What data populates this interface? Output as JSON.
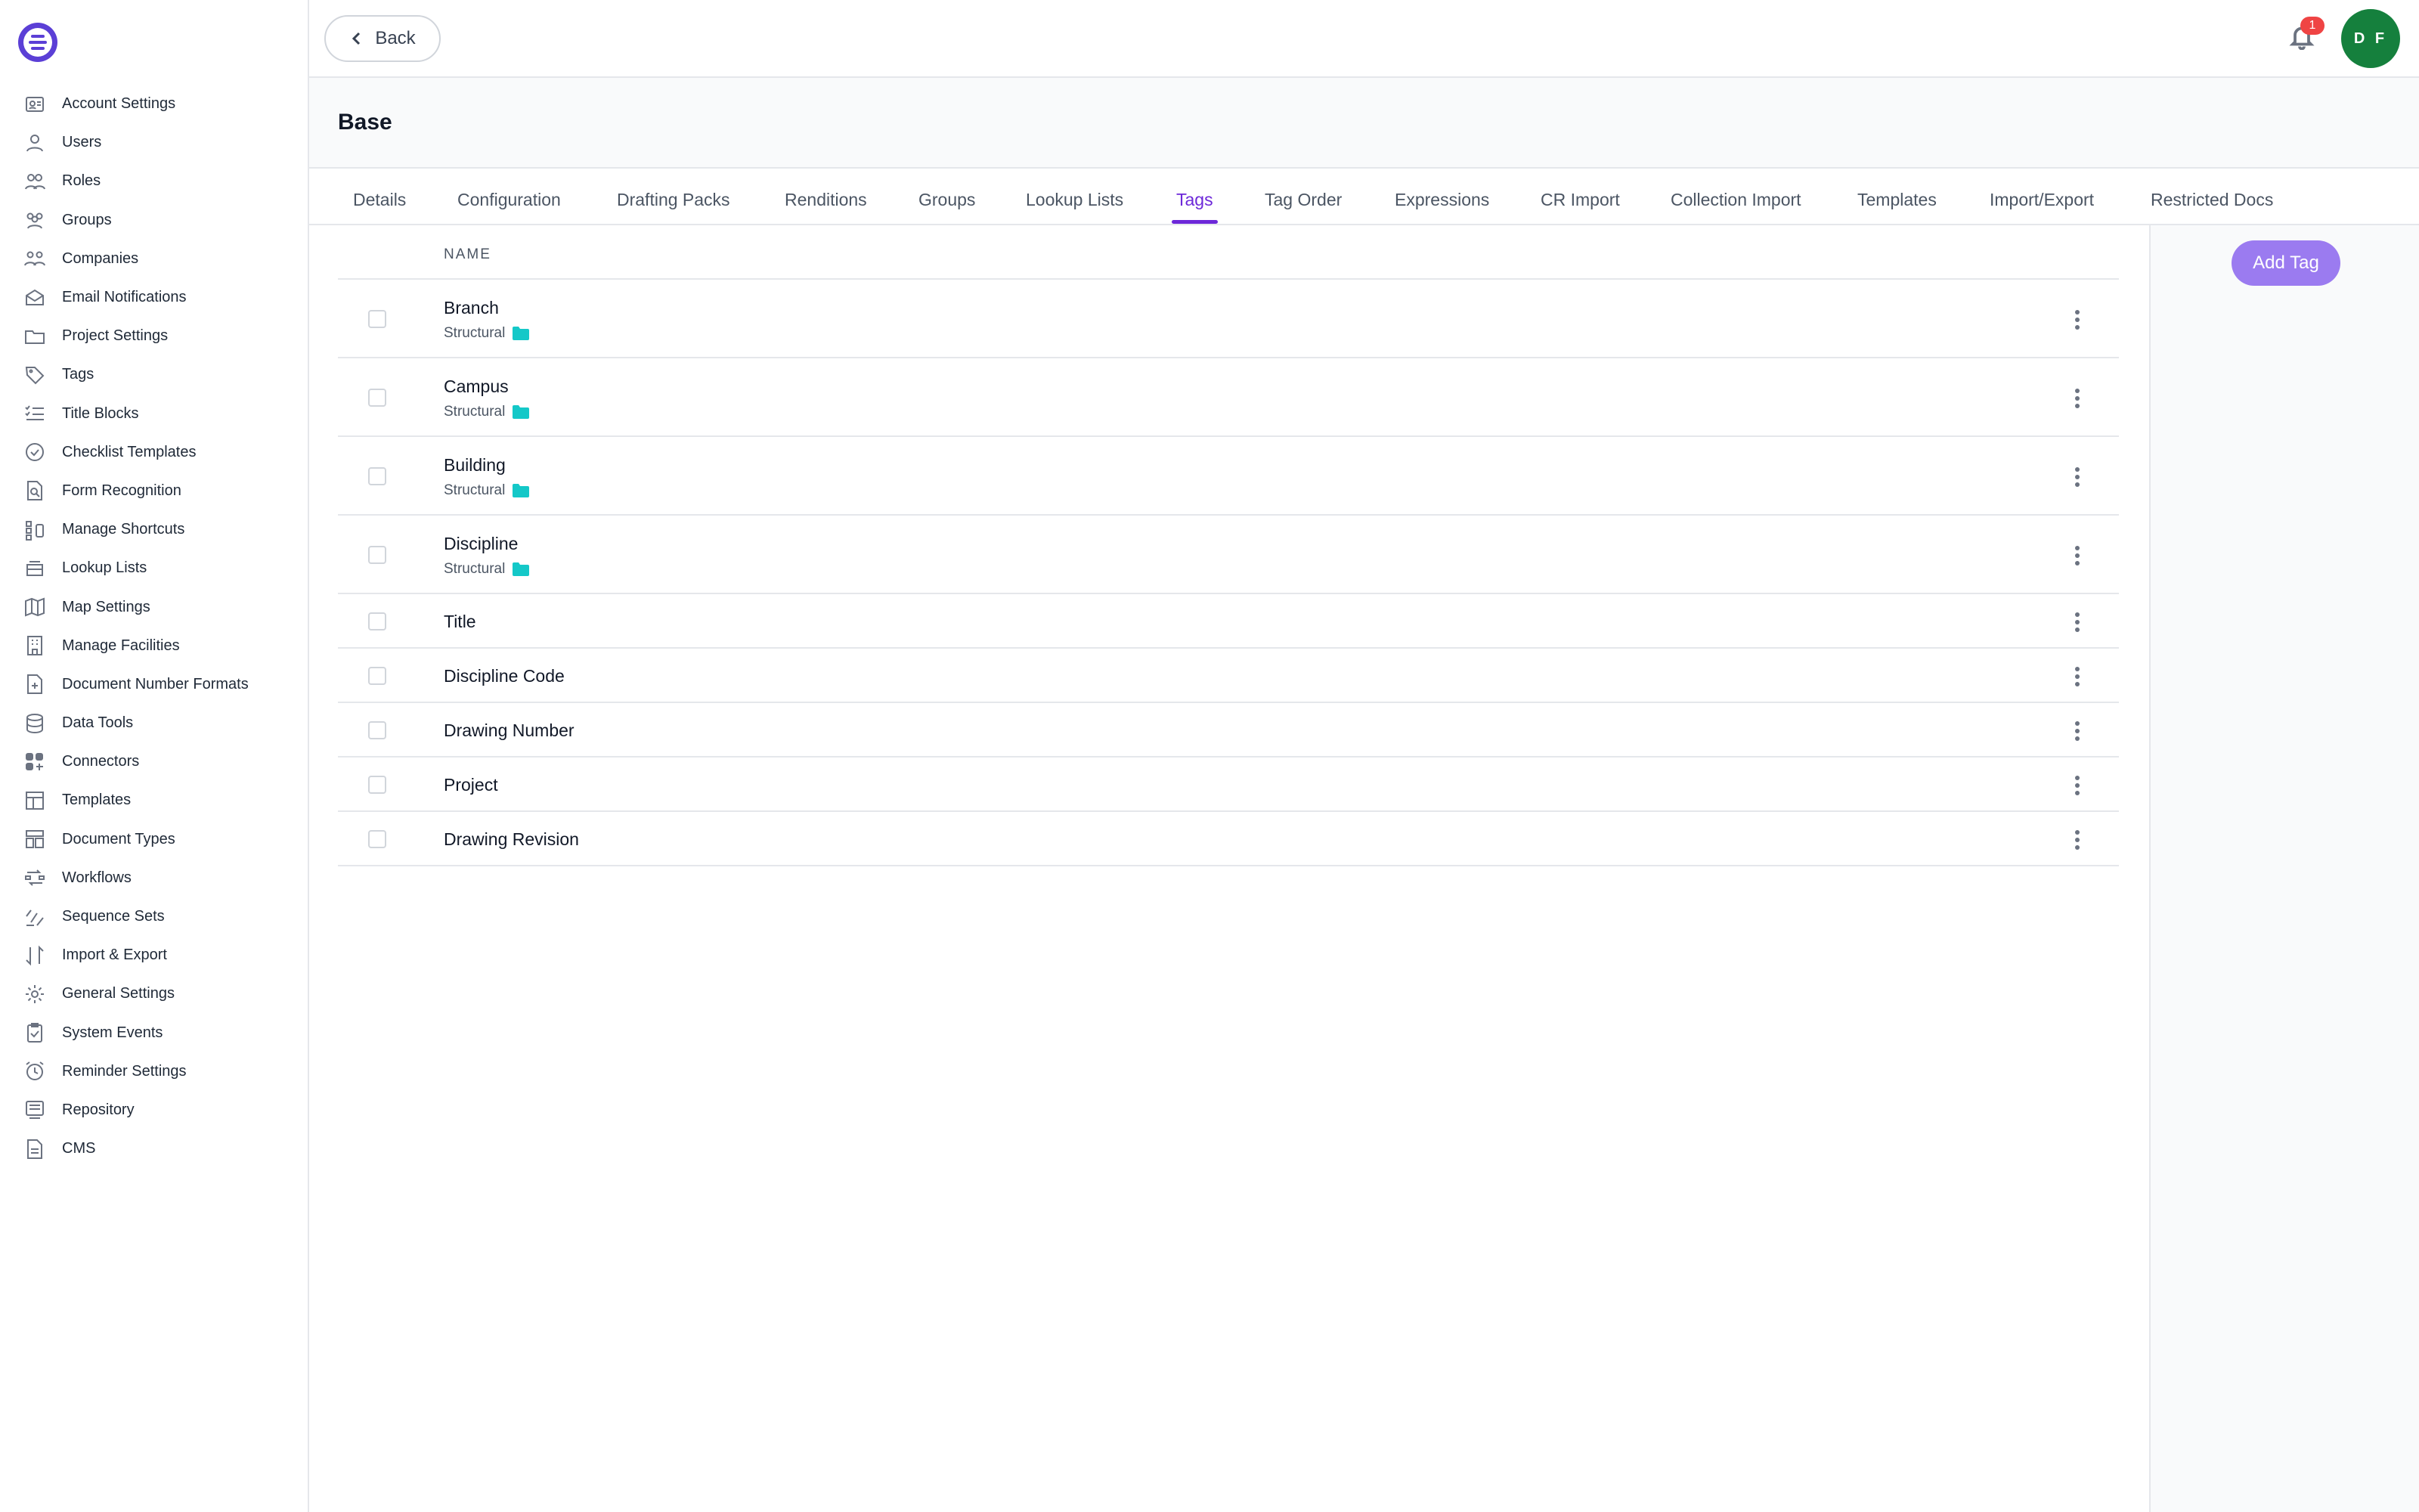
{
  "sidebar": {
    "items": [
      {
        "label": "Account Settings",
        "icon": "account-settings-icon"
      },
      {
        "label": "Users",
        "icon": "users-icon"
      },
      {
        "label": "Roles",
        "icon": "roles-icon"
      },
      {
        "label": "Groups",
        "icon": "groups-icon"
      },
      {
        "label": "Companies",
        "icon": "companies-icon"
      },
      {
        "label": "Email Notifications",
        "icon": "email-icon"
      },
      {
        "label": "Project Settings",
        "icon": "folder-icon"
      },
      {
        "label": "Tags",
        "icon": "tag-icon"
      },
      {
        "label": "Title Blocks",
        "icon": "checklist-icon"
      },
      {
        "label": "Checklist Templates",
        "icon": "check-circle-icon"
      },
      {
        "label": "Form Recognition",
        "icon": "form-search-icon"
      },
      {
        "label": "Manage Shortcuts",
        "icon": "shortcuts-icon"
      },
      {
        "label": "Lookup Lists",
        "icon": "stack-icon"
      },
      {
        "label": "Map Settings",
        "icon": "map-icon"
      },
      {
        "label": "Manage Facilities",
        "icon": "building-icon"
      },
      {
        "label": "Document Number Formats",
        "icon": "document-plus-icon"
      },
      {
        "label": "Data Tools",
        "icon": "database-icon"
      },
      {
        "label": "Connectors",
        "icon": "connectors-icon"
      },
      {
        "label": "Templates",
        "icon": "template-icon"
      },
      {
        "label": "Document Types",
        "icon": "document-types-icon"
      },
      {
        "label": "Workflows",
        "icon": "workflow-icon"
      },
      {
        "label": "Sequence Sets",
        "icon": "sequence-icon"
      },
      {
        "label": "Import & Export",
        "icon": "import-export-icon"
      },
      {
        "label": "General Settings",
        "icon": "gear-icon"
      },
      {
        "label": "System Events",
        "icon": "clipboard-check-icon"
      },
      {
        "label": "Reminder Settings",
        "icon": "alarm-clock-icon"
      },
      {
        "label": "Repository",
        "icon": "repository-icon"
      },
      {
        "label": "CMS",
        "icon": "document-icon"
      }
    ]
  },
  "topbar": {
    "back_label": "Back",
    "notification_count": "1",
    "avatar_initials": "D F"
  },
  "page": {
    "title": "Base"
  },
  "tabs": [
    {
      "label": "Details",
      "active": false
    },
    {
      "label": "Configuration",
      "active": false
    },
    {
      "label": "Drafting Packs",
      "active": false
    },
    {
      "label": "Renditions",
      "active": false
    },
    {
      "label": "Groups",
      "active": false
    },
    {
      "label": "Lookup Lists",
      "active": false
    },
    {
      "label": "Tags",
      "active": true
    },
    {
      "label": "Tag Order",
      "active": false
    },
    {
      "label": "Expressions",
      "active": false
    },
    {
      "label": "CR Import",
      "active": false
    },
    {
      "label": "Collection Import",
      "active": false
    },
    {
      "label": "Templates",
      "active": false
    },
    {
      "label": "Import/Export",
      "active": false
    },
    {
      "label": "Restricted Docs",
      "active": false
    }
  ],
  "table": {
    "header_name": "NAME",
    "rows": [
      {
        "name": "Branch",
        "type": "Structural"
      },
      {
        "name": "Campus",
        "type": "Structural"
      },
      {
        "name": "Building",
        "type": "Structural"
      },
      {
        "name": "Discipline",
        "type": "Structural"
      },
      {
        "name": "Title",
        "type": ""
      },
      {
        "name": "Discipline Code",
        "type": ""
      },
      {
        "name": "Drawing Number",
        "type": ""
      },
      {
        "name": "Project",
        "type": ""
      },
      {
        "name": "Drawing Revision",
        "type": ""
      }
    ]
  },
  "actions": {
    "add_tag_label": "Add Tag"
  },
  "colors": {
    "accent": "#6d28d9",
    "add_button": "#9b7bf0",
    "avatar": "#15803d",
    "badge": "#ef4444",
    "folder": "#14c8c8"
  }
}
